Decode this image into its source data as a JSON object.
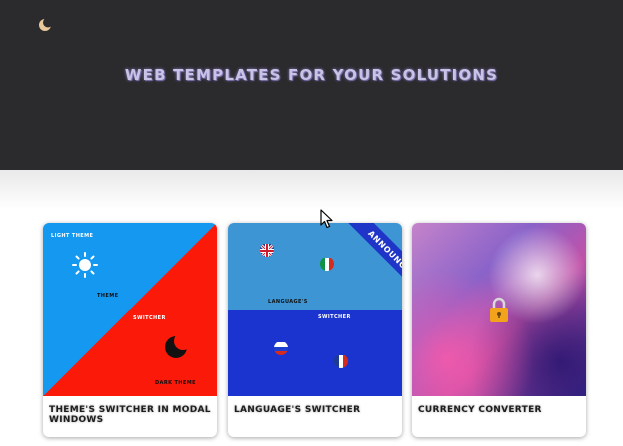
{
  "header": {
    "theme_toggle_icon": "moon-icon",
    "title": "WEB TEMPLATES FOR YOUR SOLUTIONS"
  },
  "cards": [
    {
      "title": "THEME'S SWITCHER IN MODAL WINDOWS",
      "thumb": {
        "light_label": "LIGHT THEME",
        "theme_label": "THEME",
        "switcher_label": "SWITCHER",
        "dark_label": "DARK THEME",
        "icons": [
          "sun-icon",
          "moon-icon"
        ]
      }
    },
    {
      "title": "LANGUAGE'S SWITCHER",
      "thumb": {
        "ribbon": "ANNOUNCED",
        "languages_label": "LANGUAGE'S",
        "switcher_label": "SWITCHER",
        "flags": [
          "uk-flag-icon",
          "italy-flag-icon",
          "russia-flag-icon",
          "france-flag-icon"
        ]
      }
    },
    {
      "title": "CURRENCY CONVERTER",
      "thumb": {
        "icons": [
          "lock-icon"
        ]
      }
    }
  ],
  "colors": {
    "hero_bg": "#2b2a2c",
    "theme_light": "#1598f0",
    "theme_dark": "#fb1a0a",
    "lang_top": "#3d95d3",
    "lang_bottom": "#1b34d0",
    "ribbon": "#1f35c8"
  }
}
